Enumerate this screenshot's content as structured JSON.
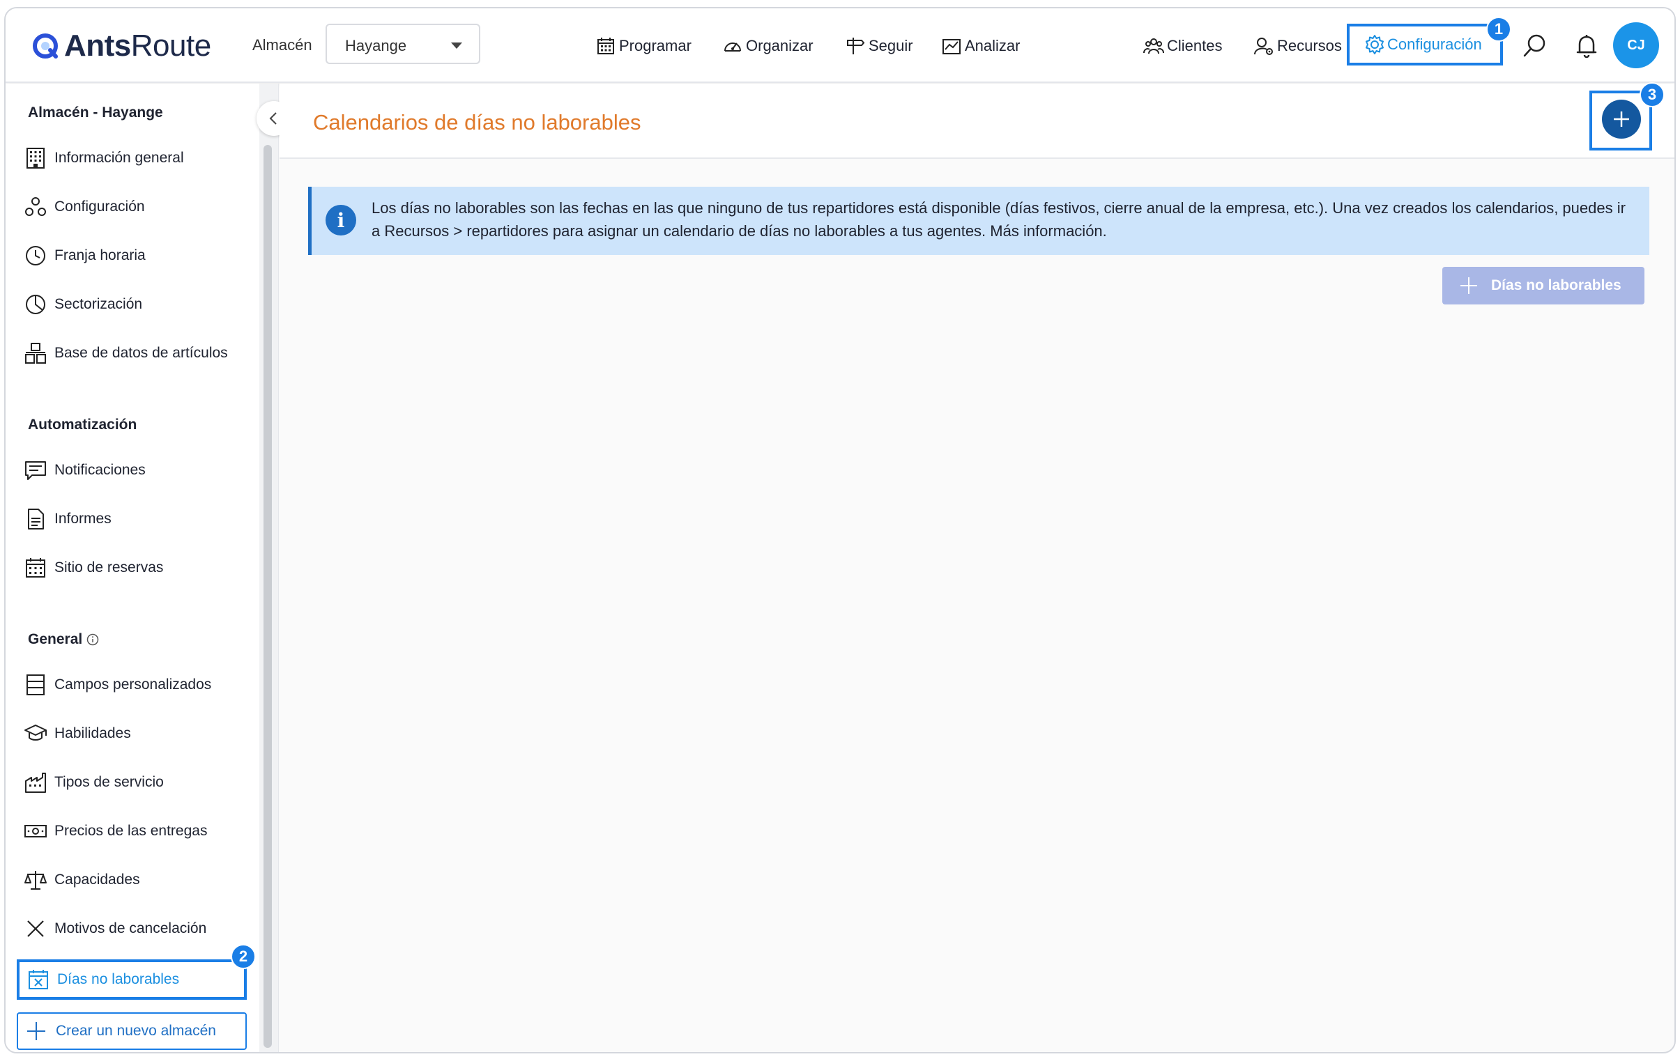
{
  "app": {
    "logo_bold": "Ants",
    "logo_light": "Route"
  },
  "header": {
    "warehouse_label": "Almacén",
    "warehouse_value": "Hayange",
    "nav": {
      "schedule": "Programar",
      "organize": "Organizar",
      "track": "Seguir",
      "analyze": "Analizar",
      "clients": "Clientes",
      "resources": "Recursos",
      "settings": "Configuración"
    },
    "avatar_initials": "CJ"
  },
  "badges": {
    "one": "1",
    "two": "2",
    "three": "3"
  },
  "sidebar": {
    "section_warehouse": "Almacén - Hayange",
    "general_info": "Información general",
    "configuration": "Configuración",
    "time_window": "Franja horaria",
    "sectorization": "Sectorización",
    "articles_db": "Base de datos de artículos",
    "section_automation": "Automatización",
    "notifications": "Notificaciones",
    "reports": "Informes",
    "booking_site": "Sitio de reservas",
    "section_general": "General",
    "custom_fields": "Campos personalizados",
    "skills": "Habilidades",
    "service_types": "Tipos de servicio",
    "delivery_prices": "Precios de las entregas",
    "capacities": "Capacidades",
    "cancel_reasons": "Motivos de cancelación",
    "non_working_days": "Días no laborables",
    "create_warehouse": "Crear un nuevo almacén"
  },
  "main": {
    "title": "Calendarios de días no laborables",
    "info_text": "Los días no laborables son las fechas en las que ninguno de tus repartidores está disponible (días festivos, cierre anual de la empresa, etc.). Una vez creados los calendarios, puedes ir a Recursos > repartidores para asignar un calendario de días no laborables a tus agentes. Más información.",
    "add_days_button": "Días no laborables"
  },
  "colors": {
    "accent": "#1a7ee6",
    "title_orange": "#e07a2b",
    "info_bg": "#cde4fb",
    "disabled_button": "#a9b7e6",
    "add_circle": "#14589f"
  }
}
